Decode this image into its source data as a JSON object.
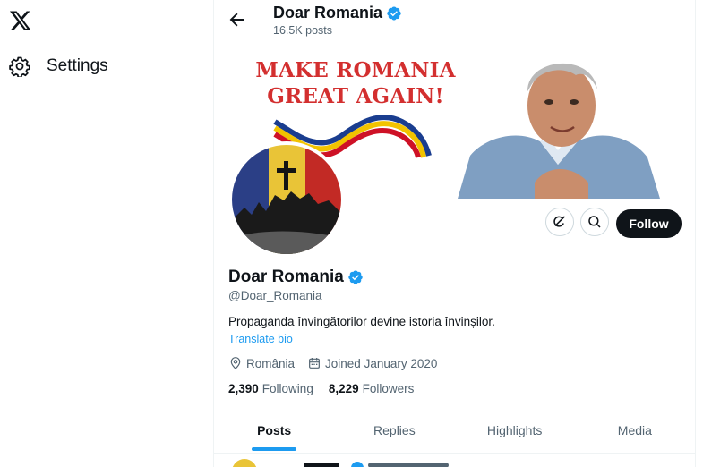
{
  "nav": {
    "logo_icon": "x-logo-icon",
    "settings_icon": "gear-icon",
    "settings_label": "Settings"
  },
  "header": {
    "back_icon": "arrow-left-icon",
    "title": "Doar Romania",
    "post_count": "16.5K posts"
  },
  "banner": {
    "line1": "MAKE ROMANIA",
    "line2": "GREAT AGAIN!"
  },
  "profile": {
    "name": "Doar Romania",
    "handle": "@Doar_Romania",
    "bio": "Propaganda învingătorilor devine istoria învinșilor.",
    "translate_label": "Translate bio",
    "location": "România",
    "joined": "Joined January 2020",
    "following_count": "2,390",
    "following_label": "Following",
    "followers_count": "8,229",
    "followers_label": "Followers"
  },
  "actions": {
    "grok_icon": "grok-icon",
    "search_icon": "search-icon",
    "follow_label": "Follow"
  },
  "tabs": [
    {
      "label": "Posts"
    },
    {
      "label": "Replies"
    },
    {
      "label": "Highlights"
    },
    {
      "label": "Media"
    }
  ],
  "colors": {
    "accent": "#1d9bf0",
    "text": "#0f1419",
    "secondary": "#536471",
    "banner_text": "#d32f2f"
  }
}
